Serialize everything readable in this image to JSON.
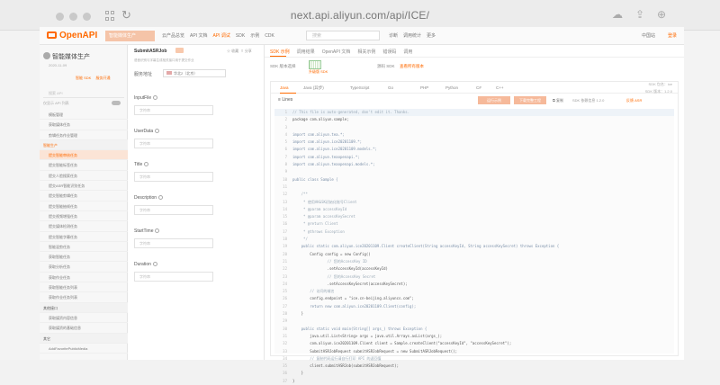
{
  "browser": {
    "url": "next.api.aliyun.com/api/ICE/"
  },
  "appbar": {
    "logo_text": "OpenAPI",
    "product_button": "智能媒体生产",
    "nav_links": [
      "云产品总览",
      "API 文档",
      "API 调试",
      "SDK",
      "示例",
      "CDK"
    ],
    "active_nav": "API 调试",
    "search_placeholder": "搜索",
    "nav_links2": [
      "诊断",
      "调用统计",
      "更多"
    ],
    "region": "中国站",
    "login": "登录"
  },
  "left": {
    "product_title": "智能媒体生产",
    "version": "2020-11-09",
    "product_links": [
      "智能 SDK",
      "服务开通"
    ],
    "search_placeholder": "搜索 API",
    "option_label": "仅显示 API 列表",
    "menu": [
      {
        "label": "模板管理",
        "type": "item"
      },
      {
        "label": "获取媒体任务",
        "type": "item"
      },
      {
        "label": "剪辑任务作业管理",
        "type": "item"
      },
      {
        "label": "智能生产",
        "type": "group-orange"
      },
      {
        "label": "提交智能审核任务",
        "type": "active"
      },
      {
        "label": "提交智能标签任务",
        "type": "item"
      },
      {
        "label": "提交人脸搜索任务",
        "type": "item"
      },
      {
        "label": "提交ASR智能识别任务",
        "type": "item"
      },
      {
        "label": "提交智能剪辑任务",
        "type": "item"
      },
      {
        "label": "提交智能抽帧任务",
        "type": "item"
      },
      {
        "label": "提交视频增强任务",
        "type": "item"
      },
      {
        "label": "提交媒体检测任务",
        "type": "item"
      },
      {
        "label": "提交智能字幕任务",
        "type": "item"
      },
      {
        "label": "智能混剪任务",
        "type": "item"
      },
      {
        "label": "获取智能任务",
        "type": "item"
      },
      {
        "label": "获取分析任务",
        "type": "item"
      },
      {
        "label": "获取作业任务",
        "type": "item"
      },
      {
        "label": "获取智能任务列表",
        "type": "item"
      },
      {
        "label": "获取作业任务列表",
        "type": "item"
      },
      {
        "label": "其他接口",
        "type": "group"
      },
      {
        "label": "获取媒资内容信息",
        "type": "item"
      },
      {
        "label": "获取媒资的基础信息",
        "type": "item"
      },
      {
        "label": "其它",
        "type": "group"
      },
      {
        "label": "AddFavoritePublicMedia",
        "type": "item"
      }
    ]
  },
  "mid": {
    "api_name": "SubmitASRJob",
    "api_collect": "收藏",
    "api_share": "分享",
    "api_desc": "语音识别与字幕生成相关接口用于提交作业",
    "service_label": "服务地址",
    "service_value": "华北2（北京）",
    "fields": [
      {
        "label": "InputFile",
        "placeholder": "字符串"
      },
      {
        "label": "UserData",
        "placeholder": "字符串"
      },
      {
        "label": "Title",
        "placeholder": "字符串"
      },
      {
        "label": "Description",
        "placeholder": "字符串"
      },
      {
        "label": "StartTime",
        "placeholder": "字符串"
      },
      {
        "label": "Duration",
        "placeholder": "字符串"
      }
    ]
  },
  "right": {
    "tabs": [
      "SDK 示例",
      "调用结果",
      "OpenAPI 文档",
      "相关示例",
      "错误码",
      "调用"
    ],
    "active_tab": "SDK 示例",
    "sdk_label": "SDK 版本选择",
    "sdk_info": "升级版 SDK",
    "sdk_download": "源码 SDK",
    "sdk_link": "查看所有版本",
    "languages": [
      "Java",
      "Java (异步)",
      "TypeScript",
      "Go",
      "PHP",
      "Python",
      "C#",
      "C++"
    ],
    "active_language": "Java",
    "sdk_version": "SDK 包名：ice",
    "sdk_version2": "SDK 版本：1.2.0",
    "lines_label": "Lines",
    "run_button": "运行示例",
    "download_button": "下载完整工程",
    "copy_button": "复制",
    "debug_button": "SDK 依赖信息 1.2.0",
    "feedback_button": "反馈 ASR",
    "code": [
      {
        "t": "// This file is auto-generated, don't edit it. Thanks.",
        "k": "c"
      },
      {
        "t": "package com.aliyun.sample;",
        "k": ""
      },
      {
        "t": "",
        "k": ""
      },
      {
        "t": "import com.aliyun.tea.*;",
        "k": "k"
      },
      {
        "t": "import com.aliyun.ice20201109.*;",
        "k": "k"
      },
      {
        "t": "import com.aliyun.ice20201109.models.*;",
        "k": "k"
      },
      {
        "t": "import com.aliyun.teaopenapi.*;",
        "k": "k"
      },
      {
        "t": "import com.aliyun.teaopenapi.models.*;",
        "k": "k"
      },
      {
        "t": "",
        "k": ""
      },
      {
        "t": "public class Sample {",
        "k": "k"
      },
      {
        "t": "",
        "k": ""
      },
      {
        "t": "    /**",
        "k": "c"
      },
      {
        "t": "     * 使用AK&SK初始化账号Client",
        "k": "c"
      },
      {
        "t": "     * @param accessKeyId",
        "k": "c"
      },
      {
        "t": "     * @param accessKeySecret",
        "k": "c"
      },
      {
        "t": "     * @return Client",
        "k": "c"
      },
      {
        "t": "     * @throws Exception",
        "k": "c"
      },
      {
        "t": "     */",
        "k": "c"
      },
      {
        "t": "    public static com.aliyun.ice20201109.Client createClient(String accessKeyId, String accessKeySecret) throws Exception {",
        "k": "k"
      },
      {
        "t": "        Config config = new Config()",
        "k": ""
      },
      {
        "t": "                // 您的AccessKey ID",
        "k": "c"
      },
      {
        "t": "                .setAccessKeyId(accessKeyId)",
        "k": ""
      },
      {
        "t": "                // 您的AccessKey Secret",
        "k": "c"
      },
      {
        "t": "                .setAccessKeySecret(accessKeySecret);",
        "k": ""
      },
      {
        "t": "        // 访问的域名",
        "k": "c"
      },
      {
        "t": "        config.endpoint = \"ice.cn-beijing.aliyuncs.com\";",
        "k": ""
      },
      {
        "t": "        return new com.aliyun.ice20201109.Client(config);",
        "k": "k"
      },
      {
        "t": "    }",
        "k": ""
      },
      {
        "t": "",
        "k": ""
      },
      {
        "t": "    public static void main(String[] args_) throws Exception {",
        "k": "k"
      },
      {
        "t": "        java.util.List<String> args = java.util.Arrays.asList(args_);",
        "k": ""
      },
      {
        "t": "        com.aliyun.ice20201109.Client client = Sample.createClient(\"accessKeyId\", \"accessKeySecret\");",
        "k": ""
      },
      {
        "t": "        SubmitASRJobRequest submitASRJobRequest = new SubmitASRJobRequest();",
        "k": ""
      },
      {
        "t": "        // 复制代码运行请自行打印 API 的返回值",
        "k": "c"
      },
      {
        "t": "        client.submitASRJob(submitASRJobRequest);",
        "k": ""
      },
      {
        "t": "    }",
        "k": ""
      },
      {
        "t": "}",
        "k": ""
      }
    ]
  },
  "colors": {
    "accent": "#ff6a00",
    "accent_light": "#f6b99a"
  }
}
